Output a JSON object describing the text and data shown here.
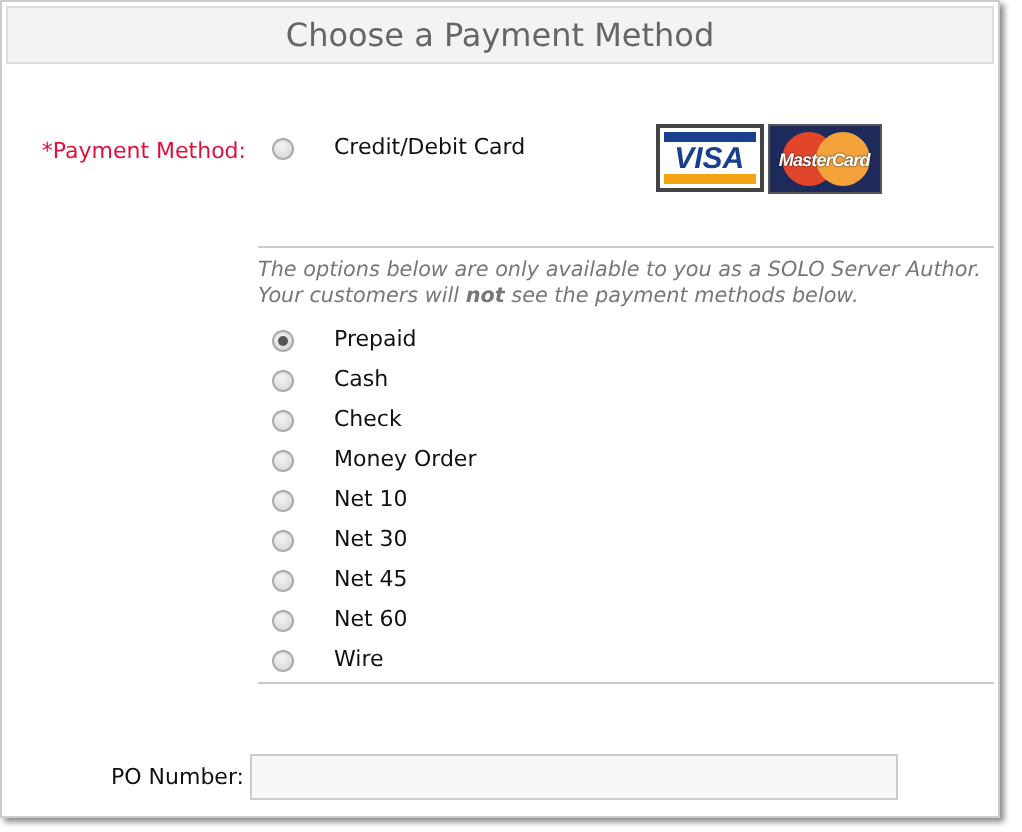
{
  "header": {
    "title": "Choose a Payment Method"
  },
  "payment_method": {
    "label": "*Payment Method:",
    "card_option": {
      "label": "Credit/Debit Card",
      "selected": false
    },
    "card_logos": [
      {
        "kind": "visa",
        "text": "VISA"
      },
      {
        "kind": "mastercard",
        "text": "MasterCard"
      }
    ]
  },
  "note": "The options below are only available to you as a SOLO Server Author. Your customers will **not** see the payment methods below.",
  "author_options": [
    {
      "label": "Prepaid",
      "selected": true
    },
    {
      "label": "Cash",
      "selected": false
    },
    {
      "label": "Check",
      "selected": false
    },
    {
      "label": "Money Order",
      "selected": false
    },
    {
      "label": "Net 10",
      "selected": false
    },
    {
      "label": "Net 30",
      "selected": false
    },
    {
      "label": "Net 45",
      "selected": false
    },
    {
      "label": "Net 60",
      "selected": false
    },
    {
      "label": "Wire",
      "selected": false
    }
  ],
  "po_number": {
    "label": "PO Number:"
  }
}
